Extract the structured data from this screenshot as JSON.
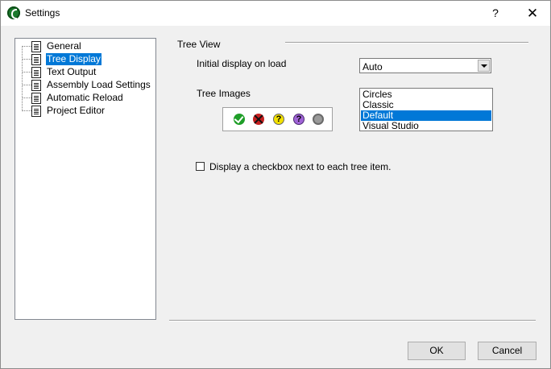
{
  "window": {
    "title": "Settings",
    "help_glyph": "?",
    "close_glyph": "✕"
  },
  "tree": {
    "items": [
      {
        "label": "General",
        "selected": false
      },
      {
        "label": "Tree Display",
        "selected": true
      },
      {
        "label": "Text Output",
        "selected": false
      },
      {
        "label": "Assembly Load Settings",
        "selected": false
      },
      {
        "label": "Automatic Reload",
        "selected": false
      },
      {
        "label": "Project Editor",
        "selected": false
      }
    ]
  },
  "tree_view": {
    "group_label": "Tree View",
    "initial_display_label": "Initial display on load",
    "initial_display_value": "Auto",
    "tree_images_label": "Tree Images",
    "image_icons": [
      "success-icon",
      "failure-icon",
      "warning-icon",
      "ignored-icon",
      "not-run-icon"
    ],
    "warn_glyph": "?",
    "ignore_glyph": "?",
    "image_sets": [
      "Circles",
      "Classic",
      "Default",
      "Visual Studio"
    ],
    "selected_image_set": "Default",
    "checkbox_label": "Display a checkbox next to each tree item.",
    "checkbox_checked": false
  },
  "buttons": {
    "ok": "OK",
    "cancel": "Cancel"
  },
  "colors": {
    "selection": "#0078d7",
    "success": "#1f9e28",
    "failure": "#c62020",
    "warning": "#f2e000",
    "ignored": "#a064d6"
  }
}
